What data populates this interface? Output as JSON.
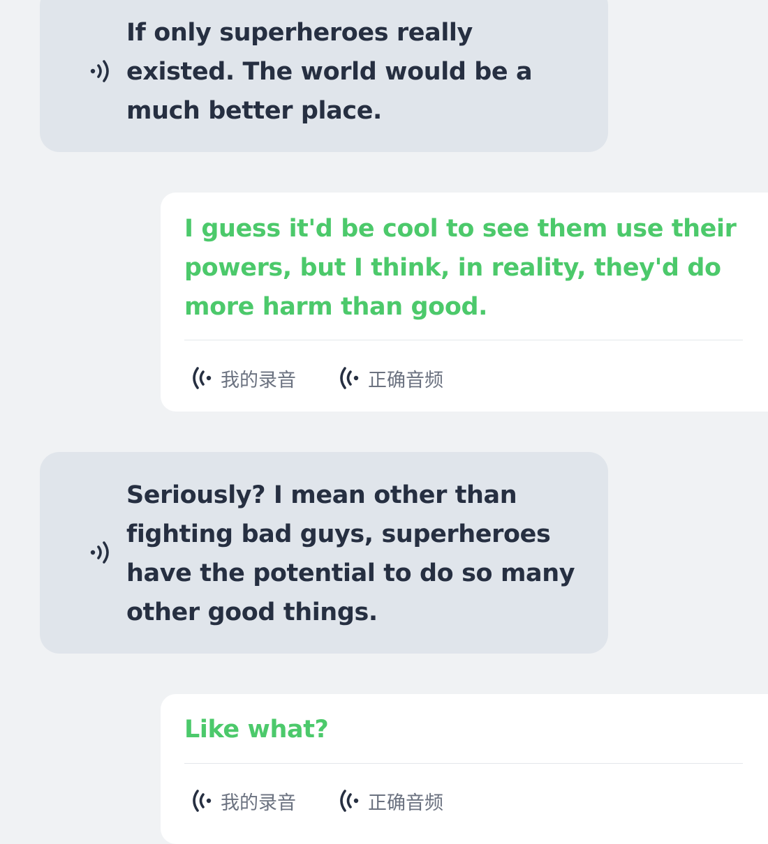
{
  "messages": [
    {
      "side": "left",
      "speaker_icon": "speaker-icon",
      "text": "If only superheroes really existed. The world would be a much better place."
    },
    {
      "side": "right",
      "text": "I guess it'd be cool to see them use their powers, but I think, in reality, they'd do more harm than good.",
      "my_recording_label": "我的录音",
      "correct_audio_label": "正确音频"
    },
    {
      "side": "left",
      "speaker_icon": "speaker-icon",
      "text": "Seriously? I mean other than fighting bad guys, superheroes have the potential to do so many other good things."
    },
    {
      "side": "right",
      "text": "Like what?",
      "my_recording_label": "我的录音",
      "correct_audio_label": "正确音频"
    }
  ],
  "colors": {
    "background": "#f0f2f4",
    "left_bubble": "#e0e5eb",
    "left_text": "#262f41",
    "right_bubble": "#ffffff",
    "right_text": "#4cc96b",
    "button_text": "#6b7280"
  }
}
